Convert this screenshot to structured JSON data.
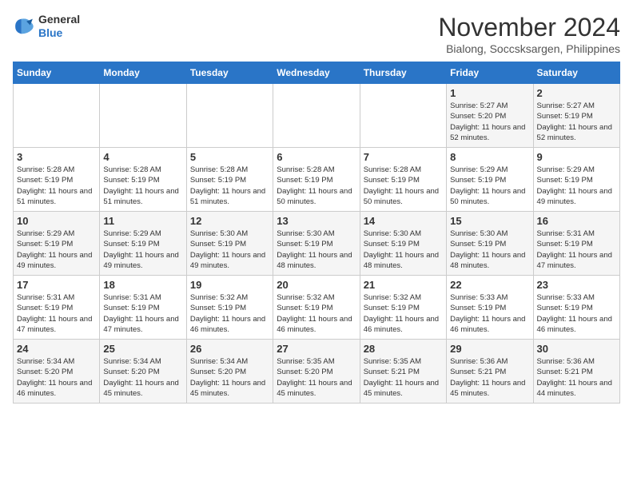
{
  "logo": {
    "line1": "General",
    "line2": "Blue"
  },
  "title": "November 2024",
  "location": "Bialong, Soccsksargen, Philippines",
  "days": [
    "Sunday",
    "Monday",
    "Tuesday",
    "Wednesday",
    "Thursday",
    "Friday",
    "Saturday"
  ],
  "weeks": [
    [
      {
        "num": "",
        "info": ""
      },
      {
        "num": "",
        "info": ""
      },
      {
        "num": "",
        "info": ""
      },
      {
        "num": "",
        "info": ""
      },
      {
        "num": "",
        "info": ""
      },
      {
        "num": "1",
        "info": "Sunrise: 5:27 AM\nSunset: 5:20 PM\nDaylight: 11 hours and 52 minutes."
      },
      {
        "num": "2",
        "info": "Sunrise: 5:27 AM\nSunset: 5:19 PM\nDaylight: 11 hours and 52 minutes."
      }
    ],
    [
      {
        "num": "3",
        "info": "Sunrise: 5:28 AM\nSunset: 5:19 PM\nDaylight: 11 hours and 51 minutes."
      },
      {
        "num": "4",
        "info": "Sunrise: 5:28 AM\nSunset: 5:19 PM\nDaylight: 11 hours and 51 minutes."
      },
      {
        "num": "5",
        "info": "Sunrise: 5:28 AM\nSunset: 5:19 PM\nDaylight: 11 hours and 51 minutes."
      },
      {
        "num": "6",
        "info": "Sunrise: 5:28 AM\nSunset: 5:19 PM\nDaylight: 11 hours and 50 minutes."
      },
      {
        "num": "7",
        "info": "Sunrise: 5:28 AM\nSunset: 5:19 PM\nDaylight: 11 hours and 50 minutes."
      },
      {
        "num": "8",
        "info": "Sunrise: 5:29 AM\nSunset: 5:19 PM\nDaylight: 11 hours and 50 minutes."
      },
      {
        "num": "9",
        "info": "Sunrise: 5:29 AM\nSunset: 5:19 PM\nDaylight: 11 hours and 49 minutes."
      }
    ],
    [
      {
        "num": "10",
        "info": "Sunrise: 5:29 AM\nSunset: 5:19 PM\nDaylight: 11 hours and 49 minutes."
      },
      {
        "num": "11",
        "info": "Sunrise: 5:29 AM\nSunset: 5:19 PM\nDaylight: 11 hours and 49 minutes."
      },
      {
        "num": "12",
        "info": "Sunrise: 5:30 AM\nSunset: 5:19 PM\nDaylight: 11 hours and 49 minutes."
      },
      {
        "num": "13",
        "info": "Sunrise: 5:30 AM\nSunset: 5:19 PM\nDaylight: 11 hours and 48 minutes."
      },
      {
        "num": "14",
        "info": "Sunrise: 5:30 AM\nSunset: 5:19 PM\nDaylight: 11 hours and 48 minutes."
      },
      {
        "num": "15",
        "info": "Sunrise: 5:30 AM\nSunset: 5:19 PM\nDaylight: 11 hours and 48 minutes."
      },
      {
        "num": "16",
        "info": "Sunrise: 5:31 AM\nSunset: 5:19 PM\nDaylight: 11 hours and 47 minutes."
      }
    ],
    [
      {
        "num": "17",
        "info": "Sunrise: 5:31 AM\nSunset: 5:19 PM\nDaylight: 11 hours and 47 minutes."
      },
      {
        "num": "18",
        "info": "Sunrise: 5:31 AM\nSunset: 5:19 PM\nDaylight: 11 hours and 47 minutes."
      },
      {
        "num": "19",
        "info": "Sunrise: 5:32 AM\nSunset: 5:19 PM\nDaylight: 11 hours and 46 minutes."
      },
      {
        "num": "20",
        "info": "Sunrise: 5:32 AM\nSunset: 5:19 PM\nDaylight: 11 hours and 46 minutes."
      },
      {
        "num": "21",
        "info": "Sunrise: 5:32 AM\nSunset: 5:19 PM\nDaylight: 11 hours and 46 minutes."
      },
      {
        "num": "22",
        "info": "Sunrise: 5:33 AM\nSunset: 5:19 PM\nDaylight: 11 hours and 46 minutes."
      },
      {
        "num": "23",
        "info": "Sunrise: 5:33 AM\nSunset: 5:19 PM\nDaylight: 11 hours and 46 minutes."
      }
    ],
    [
      {
        "num": "24",
        "info": "Sunrise: 5:34 AM\nSunset: 5:20 PM\nDaylight: 11 hours and 46 minutes."
      },
      {
        "num": "25",
        "info": "Sunrise: 5:34 AM\nSunset: 5:20 PM\nDaylight: 11 hours and 45 minutes."
      },
      {
        "num": "26",
        "info": "Sunrise: 5:34 AM\nSunset: 5:20 PM\nDaylight: 11 hours and 45 minutes."
      },
      {
        "num": "27",
        "info": "Sunrise: 5:35 AM\nSunset: 5:20 PM\nDaylight: 11 hours and 45 minutes."
      },
      {
        "num": "28",
        "info": "Sunrise: 5:35 AM\nSunset: 5:21 PM\nDaylight: 11 hours and 45 minutes."
      },
      {
        "num": "29",
        "info": "Sunrise: 5:36 AM\nSunset: 5:21 PM\nDaylight: 11 hours and 45 minutes."
      },
      {
        "num": "30",
        "info": "Sunrise: 5:36 AM\nSunset: 5:21 PM\nDaylight: 11 hours and 44 minutes."
      }
    ]
  ]
}
